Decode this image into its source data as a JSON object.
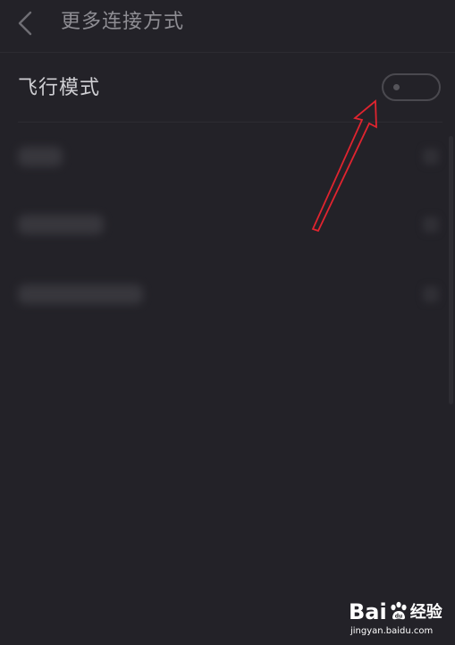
{
  "header": {
    "back_icon": "chevron-left-icon",
    "title": "更多连接方式"
  },
  "airplane_mode": {
    "label": "飞行模式",
    "toggle_state": "off"
  },
  "blurred_items": [
    {
      "label": ""
    },
    {
      "label": ""
    },
    {
      "label": ""
    }
  ],
  "annotation": {
    "arrow_color": "#e0242f"
  },
  "watermark": {
    "brand_left": "Bai",
    "brand_right": "经验",
    "url": "jingyan.baidu.com"
  },
  "colors": {
    "background": "#232228",
    "title_text": "#8e8d93",
    "label_text": "#cfcfd3",
    "toggle_border": "#4a494f"
  }
}
